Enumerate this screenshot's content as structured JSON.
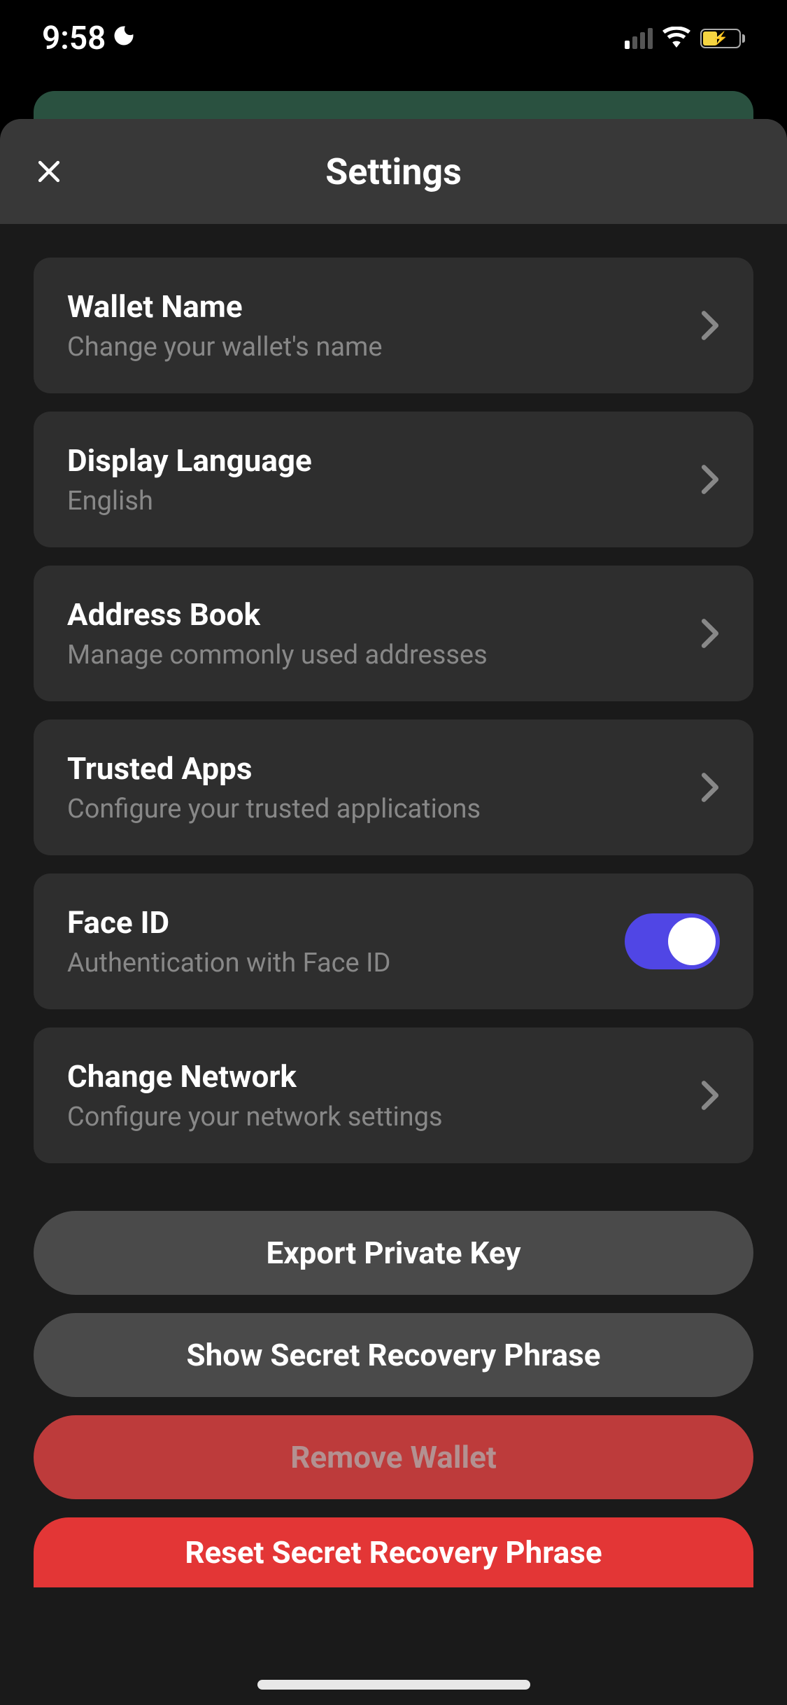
{
  "status": {
    "time": "9:58"
  },
  "header": {
    "title": "Settings"
  },
  "items": [
    {
      "title": "Wallet Name",
      "subtitle": "Change your wallet's name"
    },
    {
      "title": "Display Language",
      "subtitle": "English"
    },
    {
      "title": "Address Book",
      "subtitle": "Manage commonly used addresses"
    },
    {
      "title": "Trusted Apps",
      "subtitle": "Configure your trusted applications"
    },
    {
      "title": "Face ID",
      "subtitle": "Authentication with Face ID",
      "toggle": true
    },
    {
      "title": "Change Network",
      "subtitle": "Configure your network settings"
    }
  ],
  "actions": {
    "export": "Export Private Key",
    "show": "Show Secret Recovery Phrase",
    "remove": "Remove Wallet",
    "reset": "Reset Secret Recovery Phrase"
  }
}
